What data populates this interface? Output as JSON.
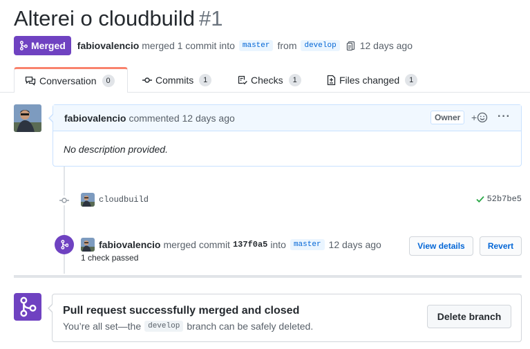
{
  "pr": {
    "title": "Alterei o cloudbuild",
    "number": "#1",
    "state_label": "Merged",
    "author": "fabiovalencio",
    "merge_text": "merged 1 commit into",
    "base_branch": "master",
    "from_text": "from",
    "head_branch": "develop",
    "time_ago": "12 days ago"
  },
  "tabs": [
    {
      "label": "Conversation",
      "count": "0",
      "icon": "comment-discussion-icon"
    },
    {
      "label": "Commits",
      "count": "1",
      "icon": "git-commit-icon"
    },
    {
      "label": "Checks",
      "count": "1",
      "icon": "checklist-icon"
    },
    {
      "label": "Files changed",
      "count": "1",
      "icon": "file-diff-icon"
    }
  ],
  "comment": {
    "author": "fabiovalencio",
    "action": "commented 12 days ago",
    "role": "Owner",
    "reaction_label": "+",
    "more_label": "···",
    "body": "No description provided."
  },
  "commit": {
    "message": "cloudbuild",
    "sha": "52b7be5"
  },
  "merge_event": {
    "author": "fabiovalencio",
    "text": "merged commit",
    "sha": "137f0a5",
    "into": "into",
    "branch": "master",
    "time_ago": "12 days ago",
    "checks": "1 check passed",
    "view_details": "View details",
    "revert": "Revert"
  },
  "merged_box": {
    "title": "Pull request successfully merged and closed",
    "desc_before": "You’re all set—the",
    "branch": "develop",
    "desc_after": "branch can be safely deleted.",
    "delete_button": "Delete branch"
  },
  "colors": {
    "merged_purple": "#6f42c1",
    "link_blue": "#0366d6",
    "success_green": "#28a745",
    "active_tab_accent": "#f9826c"
  }
}
